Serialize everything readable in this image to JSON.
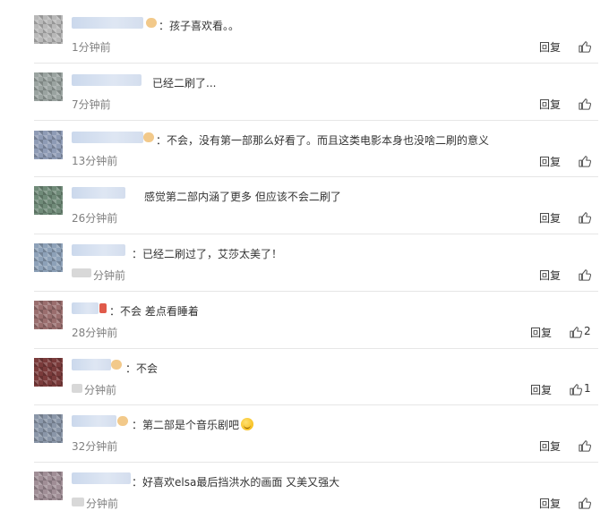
{
  "comments": [
    {
      "text": "：孩子喜欢看。。",
      "time": "1分钟前",
      "reply": "回复",
      "likes": ""
    },
    {
      "text": "已经二刷了...",
      "time": "7分钟前",
      "reply": "回复",
      "likes": ""
    },
    {
      "text": "：不会，没有第一部那么好看了。而且这类电影本身也没啥二刷的意义",
      "time": "13分钟前",
      "reply": "回复",
      "likes": ""
    },
    {
      "text": "感觉第二部内涵了更多 但应该不会二刷了",
      "time": "26分钟前",
      "reply": "回复",
      "likes": ""
    },
    {
      "text": "：已经二刷过了，艾莎太美了！",
      "time": "分钟前",
      "reply": "回复",
      "likes": ""
    },
    {
      "text": "：不会 差点看睡着",
      "time": "28分钟前",
      "reply": "回复",
      "likes": "2"
    },
    {
      "text": "：不会",
      "time": "分钟前",
      "reply": "回复",
      "likes": "1"
    },
    {
      "text": "：第二部是个音乐剧吧",
      "time": "32分钟前",
      "reply": "回复",
      "likes": ""
    },
    {
      "text": "：好喜欢elsa最后挡洪水的画面 又美又强大",
      "time": "分钟前",
      "reply": "回复",
      "likes": ""
    }
  ],
  "icons": {
    "like": "thumbs-up-icon",
    "emoji": "laughing-emoji-icon"
  },
  "colors": {
    "text": "#333333",
    "time": "#808080",
    "divider": "#e6e6e6"
  }
}
